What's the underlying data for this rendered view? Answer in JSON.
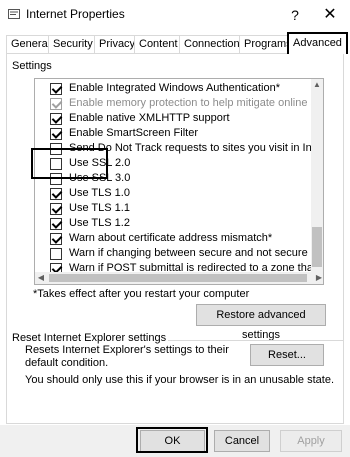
{
  "window": {
    "title": "Internet Properties",
    "help_glyph": "?",
    "close_glyph": "✕"
  },
  "tabs": [
    {
      "label": "General"
    },
    {
      "label": "Security"
    },
    {
      "label": "Privacy"
    },
    {
      "label": "Content"
    },
    {
      "label": "Connections"
    },
    {
      "label": "Programs"
    },
    {
      "label": "Advanced",
      "active": true
    }
  ],
  "settings": {
    "group_label": "Settings",
    "items": [
      {
        "label": "Enable Integrated Windows Authentication*",
        "checked": true,
        "disabled": false
      },
      {
        "label": "Enable memory protection to help mitigate online attacks*",
        "checked": true,
        "disabled": true
      },
      {
        "label": "Enable native XMLHTTP support",
        "checked": true,
        "disabled": false
      },
      {
        "label": "Enable SmartScreen Filter",
        "checked": true,
        "disabled": false
      },
      {
        "label": "Send Do Not Track requests to sites you visit in Internet E",
        "checked": false,
        "disabled": false
      },
      {
        "label": "Use SSL 2.0",
        "checked": false,
        "disabled": false
      },
      {
        "label": "Use SSL 3.0",
        "checked": false,
        "disabled": false
      },
      {
        "label": "Use TLS 1.0",
        "checked": true,
        "disabled": false
      },
      {
        "label": "Use TLS 1.1",
        "checked": true,
        "disabled": false
      },
      {
        "label": "Use TLS 1.2",
        "checked": true,
        "disabled": false
      },
      {
        "label": "Warn about certificate address mismatch*",
        "checked": true,
        "disabled": false
      },
      {
        "label": "Warn if changing between secure and not secure mode",
        "checked": false,
        "disabled": false
      },
      {
        "label": "Warn if POST submittal is redirected to a zone that does n",
        "checked": true,
        "disabled": false
      }
    ],
    "restart_note": "*Takes effect after you restart your computer",
    "restore_button": "Restore advanced settings"
  },
  "reset": {
    "group_label": "Reset Internet Explorer settings",
    "description": "Resets Internet Explorer's settings to their default condition.",
    "button": "Reset...",
    "warning": "You should only use this if your browser is in an unusable state."
  },
  "footer": {
    "ok": "OK",
    "cancel": "Cancel",
    "apply": "Apply"
  },
  "colors": {
    "highlight_border": "#000000",
    "button_face": "#e1e1e1",
    "disabled_text": "#8c8c8c"
  }
}
